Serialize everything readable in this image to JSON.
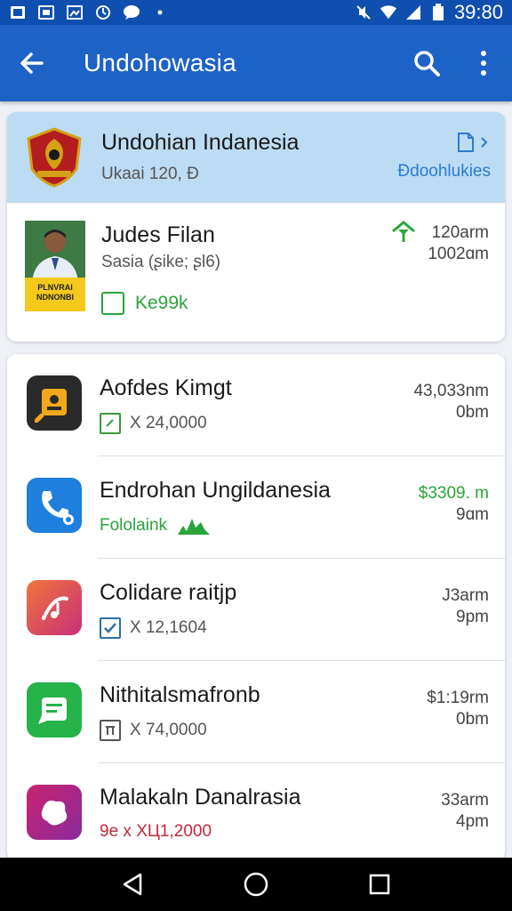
{
  "status_bar": {
    "time": "39:80",
    "icons_left": [
      "photo-icon",
      "gallery-icon",
      "image-icon",
      "sync-icon",
      "chat-icon",
      "dot-icon"
    ],
    "icons_right": [
      "mute-icon",
      "wifi-icon",
      "signal-icon",
      "battery-icon"
    ]
  },
  "app_bar": {
    "title": "Undohowasia",
    "back_icon": "arrow-left-icon",
    "search_icon": "search-icon",
    "more_icon": "more-vert-icon"
  },
  "header_card": {
    "title": "Undohian Indanesia",
    "subtitle": "Ukaai 120, Ð",
    "link": "Ɖdoohlukies",
    "doc_icon": "document-icon",
    "emblem_icon": "emblem-icon"
  },
  "person": {
    "name": "Judes Filan",
    "subtitle": "Sasia (ʂike; ʂl6)",
    "status_label": "Ke99k",
    "badge_text": "PLNVRAI NDNONBI",
    "time_1": "120arm",
    "time_2": "1002ɑm"
  },
  "list": [
    {
      "title": "Aofdes Kimgt",
      "sub": "X 24,0000",
      "time_1": "43,033nm",
      "time_2": "0bm",
      "icon": "document-badge-icon",
      "color": "#2a2a2a"
    },
    {
      "title": "Endrohan Ungildanesia",
      "sub": "Fololaink",
      "time_1": "$3309. m",
      "time_2": "9ɑm",
      "icon": "phone-icon",
      "color": "#1e7fdc",
      "green": true
    },
    {
      "title": "Colidare raitjp",
      "sub": "X 12,1604",
      "time_1": "J3arm",
      "time_2": "9pm",
      "icon": "music-icon",
      "color": "#e8563a"
    },
    {
      "title": "Nithitalsmafronb",
      "sub": "X 74,0000",
      "time_1": "$1:19rm",
      "time_2": "0bm",
      "icon": "list-card-icon",
      "color": "#26b34a"
    },
    {
      "title": "Malakaln Danalrasia",
      "sub": "9e x XЦ1,2000",
      "time_1": "33arm",
      "time_2": "4pm",
      "icon": "blob-icon",
      "color": "#d42f7e",
      "red": true
    }
  ],
  "nav_bar": {
    "back": "nav-back-icon",
    "home": "nav-home-icon",
    "recents": "nav-recents-icon"
  }
}
